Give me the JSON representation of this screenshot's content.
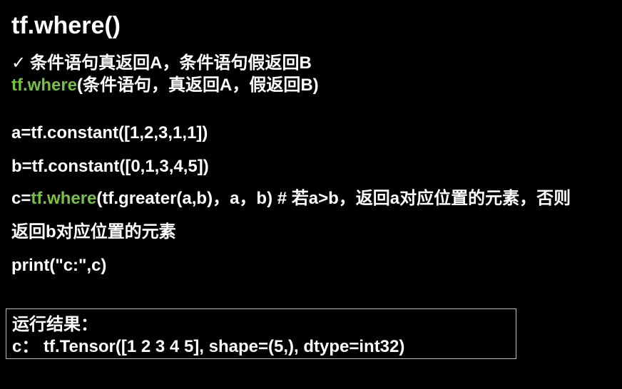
{
  "title": "tf.where()",
  "bullet": {
    "icon": "checkmark-icon",
    "glyph": "✓",
    "text": "条件语句真返回A，条件语句假返回B"
  },
  "syntax": {
    "fn": "tf.where",
    "args": "(条件语句，真返回A，假返回B)"
  },
  "code": {
    "line_a": "a=tf.constant([1,2,3,1,1])",
    "line_b": "b=tf.constant([0,1,3,4,5])",
    "line_c_prefix": "c=",
    "line_c_fn": "tf.where",
    "line_c_rest": "(tf.greater(a,b)，a，b)  # 若a>b，返回a对应位置的元素，否则",
    "line_c_wrap": "返回b对应位置的元素",
    "line_print": "print(\"c:\",c)"
  },
  "result": {
    "label": "运行结果：",
    "output": "c：  tf.Tensor([1 2 3 4 5], shape=(5,), dtype=int32)"
  },
  "colors": {
    "background": "#000000",
    "text": "#ffffff",
    "accent_green": "#77c043",
    "box_border": "#bfbfbf"
  }
}
